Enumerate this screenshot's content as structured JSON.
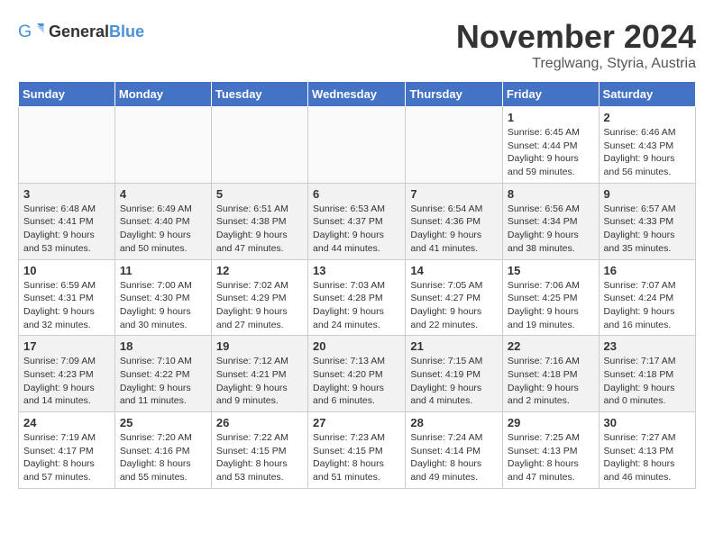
{
  "logo": {
    "text_general": "General",
    "text_blue": "Blue",
    "icon": "🔵"
  },
  "title": "November 2024",
  "subtitle": "Treglwang, Styria, Austria",
  "weekdays": [
    "Sunday",
    "Monday",
    "Tuesday",
    "Wednesday",
    "Thursday",
    "Friday",
    "Saturday"
  ],
  "weeks": [
    [
      {
        "day": "",
        "info": ""
      },
      {
        "day": "",
        "info": ""
      },
      {
        "day": "",
        "info": ""
      },
      {
        "day": "",
        "info": ""
      },
      {
        "day": "",
        "info": ""
      },
      {
        "day": "1",
        "info": "Sunrise: 6:45 AM\nSunset: 4:44 PM\nDaylight: 9 hours and 59 minutes."
      },
      {
        "day": "2",
        "info": "Sunrise: 6:46 AM\nSunset: 4:43 PM\nDaylight: 9 hours and 56 minutes."
      }
    ],
    [
      {
        "day": "3",
        "info": "Sunrise: 6:48 AM\nSunset: 4:41 PM\nDaylight: 9 hours and 53 minutes."
      },
      {
        "day": "4",
        "info": "Sunrise: 6:49 AM\nSunset: 4:40 PM\nDaylight: 9 hours and 50 minutes."
      },
      {
        "day": "5",
        "info": "Sunrise: 6:51 AM\nSunset: 4:38 PM\nDaylight: 9 hours and 47 minutes."
      },
      {
        "day": "6",
        "info": "Sunrise: 6:53 AM\nSunset: 4:37 PM\nDaylight: 9 hours and 44 minutes."
      },
      {
        "day": "7",
        "info": "Sunrise: 6:54 AM\nSunset: 4:36 PM\nDaylight: 9 hours and 41 minutes."
      },
      {
        "day": "8",
        "info": "Sunrise: 6:56 AM\nSunset: 4:34 PM\nDaylight: 9 hours and 38 minutes."
      },
      {
        "day": "9",
        "info": "Sunrise: 6:57 AM\nSunset: 4:33 PM\nDaylight: 9 hours and 35 minutes."
      }
    ],
    [
      {
        "day": "10",
        "info": "Sunrise: 6:59 AM\nSunset: 4:31 PM\nDaylight: 9 hours and 32 minutes."
      },
      {
        "day": "11",
        "info": "Sunrise: 7:00 AM\nSunset: 4:30 PM\nDaylight: 9 hours and 30 minutes."
      },
      {
        "day": "12",
        "info": "Sunrise: 7:02 AM\nSunset: 4:29 PM\nDaylight: 9 hours and 27 minutes."
      },
      {
        "day": "13",
        "info": "Sunrise: 7:03 AM\nSunset: 4:28 PM\nDaylight: 9 hours and 24 minutes."
      },
      {
        "day": "14",
        "info": "Sunrise: 7:05 AM\nSunset: 4:27 PM\nDaylight: 9 hours and 22 minutes."
      },
      {
        "day": "15",
        "info": "Sunrise: 7:06 AM\nSunset: 4:25 PM\nDaylight: 9 hours and 19 minutes."
      },
      {
        "day": "16",
        "info": "Sunrise: 7:07 AM\nSunset: 4:24 PM\nDaylight: 9 hours and 16 minutes."
      }
    ],
    [
      {
        "day": "17",
        "info": "Sunrise: 7:09 AM\nSunset: 4:23 PM\nDaylight: 9 hours and 14 minutes."
      },
      {
        "day": "18",
        "info": "Sunrise: 7:10 AM\nSunset: 4:22 PM\nDaylight: 9 hours and 11 minutes."
      },
      {
        "day": "19",
        "info": "Sunrise: 7:12 AM\nSunset: 4:21 PM\nDaylight: 9 hours and 9 minutes."
      },
      {
        "day": "20",
        "info": "Sunrise: 7:13 AM\nSunset: 4:20 PM\nDaylight: 9 hours and 6 minutes."
      },
      {
        "day": "21",
        "info": "Sunrise: 7:15 AM\nSunset: 4:19 PM\nDaylight: 9 hours and 4 minutes."
      },
      {
        "day": "22",
        "info": "Sunrise: 7:16 AM\nSunset: 4:18 PM\nDaylight: 9 hours and 2 minutes."
      },
      {
        "day": "23",
        "info": "Sunrise: 7:17 AM\nSunset: 4:18 PM\nDaylight: 9 hours and 0 minutes."
      }
    ],
    [
      {
        "day": "24",
        "info": "Sunrise: 7:19 AM\nSunset: 4:17 PM\nDaylight: 8 hours and 57 minutes."
      },
      {
        "day": "25",
        "info": "Sunrise: 7:20 AM\nSunset: 4:16 PM\nDaylight: 8 hours and 55 minutes."
      },
      {
        "day": "26",
        "info": "Sunrise: 7:22 AM\nSunset: 4:15 PM\nDaylight: 8 hours and 53 minutes."
      },
      {
        "day": "27",
        "info": "Sunrise: 7:23 AM\nSunset: 4:15 PM\nDaylight: 8 hours and 51 minutes."
      },
      {
        "day": "28",
        "info": "Sunrise: 7:24 AM\nSunset: 4:14 PM\nDaylight: 8 hours and 49 minutes."
      },
      {
        "day": "29",
        "info": "Sunrise: 7:25 AM\nSunset: 4:13 PM\nDaylight: 8 hours and 47 minutes."
      },
      {
        "day": "30",
        "info": "Sunrise: 7:27 AM\nSunset: 4:13 PM\nDaylight: 8 hours and 46 minutes."
      }
    ]
  ]
}
